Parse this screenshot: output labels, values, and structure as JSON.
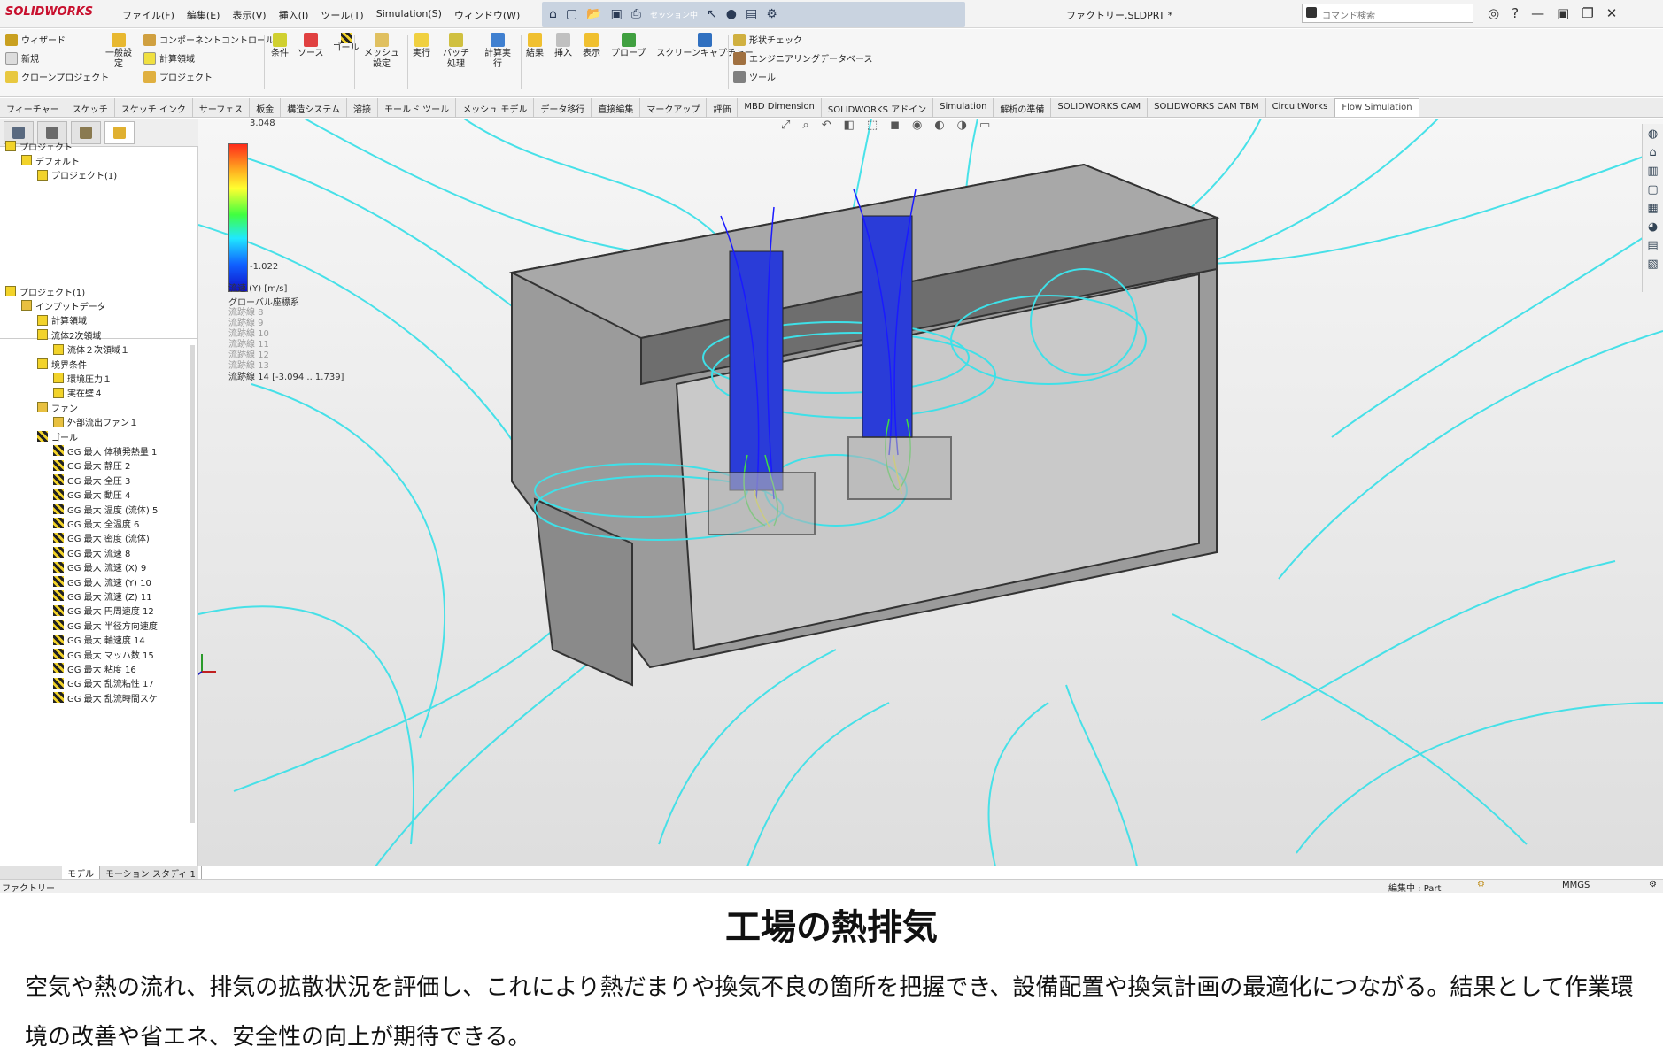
{
  "titlebar": {
    "app_name": "SOLIDWORKS",
    "menus": [
      "ファイル(F)",
      "編集(E)",
      "表示(V)",
      "挿入(I)",
      "ツール(T)",
      "Simulation(S)",
      "ウィンドウ(W)"
    ],
    "session_label": "セッション中",
    "document_title": "ファクトリー.SLDPRT *",
    "search_placeholder": "コマンド検索"
  },
  "ribbon": {
    "wizard": "ウィザード",
    "new": "新規",
    "clone": "クローンプロジェクト",
    "general": "一般設定",
    "component_control": "コンポーネントコントロール",
    "computational_domain": "計算領域",
    "project": "プロジェクト",
    "condition": "条件",
    "source": "ソース",
    "goal": "ゴール",
    "mesh": "メッシュ設定",
    "run": "実行",
    "batch": "バッチ処理",
    "calc_run": "計算実行",
    "results": "結果",
    "insert": "挿入",
    "display": "表示",
    "probe": "プローブ",
    "screen_capture": "スクリーンキャプチャー",
    "check_geometry": "形状チェック",
    "engineering_db": "エンジニアリングデータベース",
    "tools": "ツール"
  },
  "tabs": [
    "フィーチャー",
    "スケッチ",
    "スケッチ インク",
    "サーフェス",
    "板金",
    "構造システム",
    "溶接",
    "モールド ツール",
    "メッシュ モデル",
    "データ移行",
    "直接編集",
    "マークアップ",
    "評価",
    "MBD Dimension",
    "SOLIDWORKS アドイン",
    "Simulation",
    "解析の準備",
    "SOLIDWORKS CAM",
    "SOLIDWORKS CAM TBM",
    "CircuitWorks",
    "Flow Simulation"
  ],
  "active_tab": "Flow Simulation",
  "upper_tree": [
    {
      "label": "プロジェクト",
      "level": 0
    },
    {
      "label": "デフォルト",
      "level": 1
    },
    {
      "label": "プロジェクト(1)",
      "level": 2
    }
  ],
  "lower_tree": [
    {
      "label": "プロジェクト(1)",
      "level": 0,
      "icon": "project"
    },
    {
      "label": "インプットデータ",
      "level": 1,
      "icon": "folder"
    },
    {
      "label": "計算領域",
      "level": 2,
      "icon": "box"
    },
    {
      "label": "流体2次領域",
      "level": 2,
      "icon": "box"
    },
    {
      "label": "流体２次領域１",
      "level": 3,
      "icon": "box"
    },
    {
      "label": "境界条件",
      "level": 2,
      "icon": "box"
    },
    {
      "label": "環境圧力１",
      "level": 3,
      "icon": "box"
    },
    {
      "label": "実在壁４",
      "level": 3,
      "icon": "box"
    },
    {
      "label": "ファン",
      "level": 2,
      "icon": "folder"
    },
    {
      "label": "外部流出ファン１",
      "level": 3,
      "icon": "folder"
    },
    {
      "label": "ゴール",
      "level": 2,
      "icon": "flag"
    },
    {
      "label": "GG 最大 体積発熱量 1",
      "level": 3,
      "icon": "flag"
    },
    {
      "label": "GG 最大 静圧 2",
      "level": 3,
      "icon": "flag"
    },
    {
      "label": "GG 最大 全圧 3",
      "level": 3,
      "icon": "flag"
    },
    {
      "label": "GG 最大 動圧 4",
      "level": 3,
      "icon": "flag"
    },
    {
      "label": "GG 最大 温度 (流体) 5",
      "level": 3,
      "icon": "flag"
    },
    {
      "label": "GG 最大 全温度 6",
      "level": 3,
      "icon": "flag"
    },
    {
      "label": "GG 最大 密度 (流体)",
      "level": 3,
      "icon": "flag"
    },
    {
      "label": "GG 最大 流速 8",
      "level": 3,
      "icon": "flag"
    },
    {
      "label": "GG 最大 流速 (X) 9",
      "level": 3,
      "icon": "flag"
    },
    {
      "label": "GG 最大 流速 (Y) 10",
      "level": 3,
      "icon": "flag"
    },
    {
      "label": "GG 最大 流速 (Z) 11",
      "level": 3,
      "icon": "flag"
    },
    {
      "label": "GG 最大 円周速度 12",
      "level": 3,
      "icon": "flag"
    },
    {
      "label": "GG 最大 半径方向速度",
      "level": 3,
      "icon": "flag"
    },
    {
      "label": "GG 最大 軸速度 14",
      "level": 3,
      "icon": "flag"
    },
    {
      "label": "GG 最大 マッハ数 15",
      "level": 3,
      "icon": "flag"
    },
    {
      "label": "GG 最大 粘度 16",
      "level": 3,
      "icon": "flag"
    },
    {
      "label": "GG 最大 乱流粘性 17",
      "level": 3,
      "icon": "flag"
    },
    {
      "label": "GG 最大 乱流時間スケ",
      "level": 3,
      "icon": "flag"
    }
  ],
  "legend": {
    "max": "3.048",
    "min": "-1.022",
    "quantity": "流速 (Y) [m/s]",
    "coord_system": "グローバル座標系",
    "flow_lines": [
      "流跡線 8",
      "流跡線 9",
      "流跡線 10",
      "流跡線 11",
      "流跡線 12",
      "流跡線 13"
    ],
    "flow_line_active": "流跡線 14 [-3.094 .. 1.739]"
  },
  "bottom_tabs": [
    "モデル",
    "モーション スタディ 1"
  ],
  "statusbar": {
    "left": "ファクトリー",
    "editing": "編集中 : Part",
    "units": "MMGS"
  },
  "caption": {
    "title": "工場の熱排気",
    "body": "空気や熱の流れ、排気の拡散状況を評価し、これにより熱だまりや換気不良の箇所を把握でき、設備配置や換気計画の最適化につながる。結果として作業環境の改善や省エネ、安全性の向上が期待できる。"
  },
  "colors": {
    "streamline": "#3ee0e8",
    "brand": "#c8102e",
    "model_gray": "#8c8c8c"
  }
}
